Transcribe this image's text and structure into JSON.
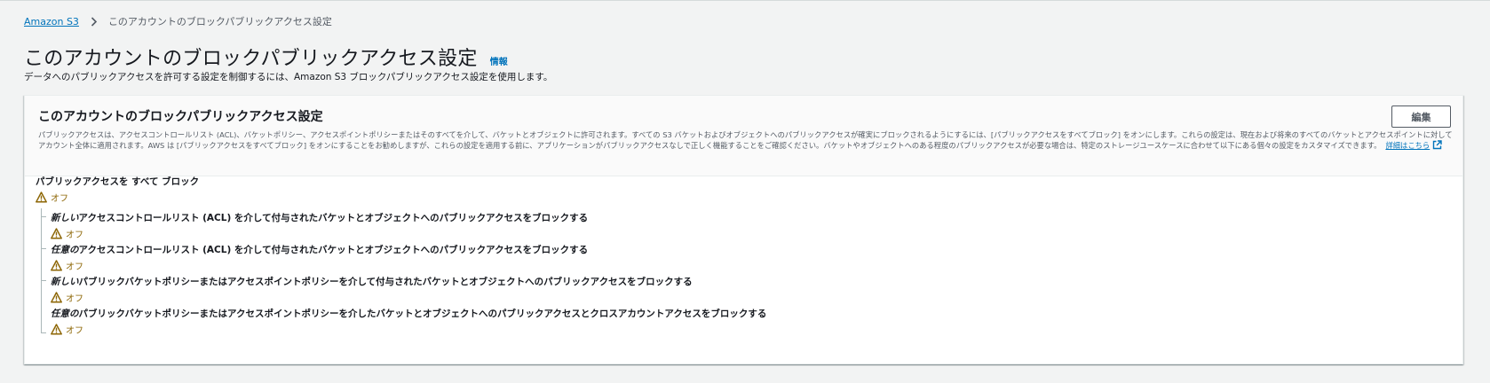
{
  "breadcrumb": {
    "root": "Amazon S3",
    "current": "このアカウントのブロックパブリックアクセス設定"
  },
  "header": {
    "title": "このアカウントのブロックパブリックアクセス設定",
    "info": "情報",
    "description": "データへのパブリックアクセスを許可する設定を制御するには、Amazon S3 ブロックパブリックアクセス設定を使用します。"
  },
  "panel": {
    "title": "このアカウントのブロックパブリックアクセス設定",
    "edit_label": "編集",
    "description": "パブリックアクセスは、アクセスコントロールリスト (ACL)、バケットポリシー、アクセスポイントポリシーまたはそのすべてを介して、バケットとオブジェクトに許可されます。すべての S3 バケットおよびオブジェクトへのパブリックアクセスが確実にブロックされるようにするには、[パブリックアクセスをすべてブロック] をオンにします。これらの設定は、現在および将来のすべてのバケットとアクセスポイントに対してアカウント全体に適用されます。AWS は [パブリックアクセスをすべてブロック] をオンにすることをお勧めしますが、これらの設定を適用する前に、アプリケーションがパブリックアクセスなしで正しく機能することをご確認ください。バケットやオブジェクトへのある程度のパブリックアクセスが必要な場合は、特定のストレージユースケースに合わせて以下にある個々の設定をカスタマイズできます。",
    "learn_more": "詳細はこちら"
  },
  "settings": {
    "main": {
      "label": "パブリックアクセスを すべて ブロック",
      "status": "オフ"
    },
    "items": [
      {
        "emph": "新しい",
        "label": "アクセスコントロールリスト (ACL) を介して付与されたバケットとオブジェクトへのパブリックアクセスをブロックする",
        "status": "オフ"
      },
      {
        "emph": "任意の",
        "label": "アクセスコントロールリスト (ACL) を介して付与されたバケットとオブジェクトへのパブリックアクセスをブロックする",
        "status": "オフ"
      },
      {
        "emph": "新しい",
        "label": "パブリックバケットポリシーまたはアクセスポイントポリシーを介して付与されたバケットとオブジェクトへのパブリックアクセスをブロックする",
        "status": "オフ"
      },
      {
        "emph": "任意の",
        "label": "パブリックバケットポリシーまたはアクセスポイントポリシーを介したバケットとオブジェクトへのパブリックアクセスとクロスアカウントアクセスをブロックする",
        "status": "オフ"
      }
    ]
  },
  "icons": {
    "breadcrumb_separator": "chevron-right-icon",
    "status": "warning-icon",
    "learn_more": "external-link-icon"
  },
  "colors": {
    "link": "#0073bb",
    "warning": "#8d6605",
    "background": "#f2f3f3"
  }
}
